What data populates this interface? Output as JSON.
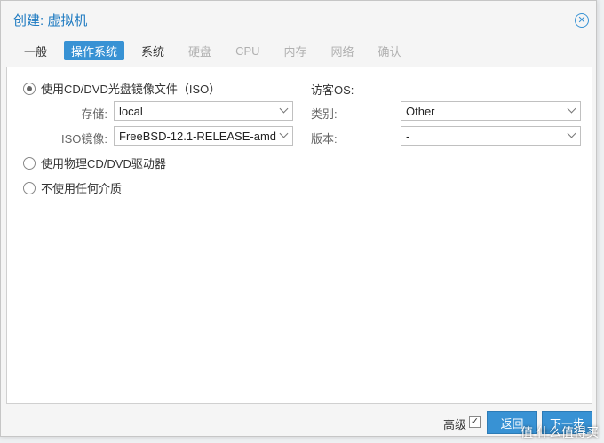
{
  "window": {
    "title": "创建: 虚拟机"
  },
  "tabs": [
    {
      "label": "一般",
      "state": "normal"
    },
    {
      "label": "操作系统",
      "state": "active"
    },
    {
      "label": "系统",
      "state": "normal"
    },
    {
      "label": "硬盘",
      "state": "disabled"
    },
    {
      "label": "CPU",
      "state": "disabled"
    },
    {
      "label": "内存",
      "state": "disabled"
    },
    {
      "label": "网络",
      "state": "disabled"
    },
    {
      "label": "确认",
      "state": "disabled"
    }
  ],
  "media": {
    "use_iso_label": "使用CD/DVD光盘镜像文件（ISO）",
    "use_iso_checked": true,
    "storage_label": "存储:",
    "storage_value": "local",
    "iso_label": "ISO镜像:",
    "iso_value": "FreeBSD-12.1-RELEASE-amd",
    "physical_label": "使用物理CD/DVD驱动器",
    "none_label": "不使用任何介质"
  },
  "guest_os": {
    "heading": "访客OS:",
    "type_label": "类别:",
    "type_value": "Other",
    "version_label": "版本:",
    "version_value": "-"
  },
  "footer": {
    "advanced_label": "高级",
    "advanced_checked": true,
    "back_label": "返回",
    "next_label": "下一步"
  },
  "watermark": "值 什么值得买",
  "colors": {
    "accent": "#3892d4",
    "title": "#1f7bc1"
  }
}
